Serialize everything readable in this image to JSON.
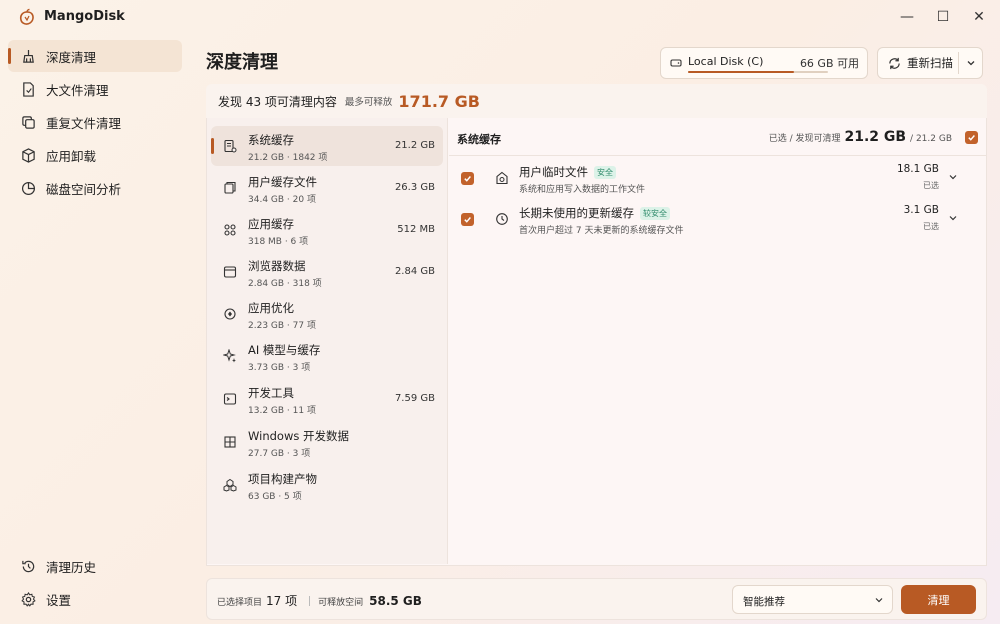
{
  "app": {
    "title": "MangoDisk",
    "logo_icon": "mango-logo-icon"
  },
  "window_controls": {
    "minimize": "—",
    "maximize": "☐",
    "close": "✕"
  },
  "sidebar": {
    "items": [
      {
        "label": "深度清理",
        "icon": "broom-icon",
        "active": true
      },
      {
        "label": "大文件清理",
        "icon": "file-icon",
        "active": false
      },
      {
        "label": "重复文件清理",
        "icon": "copy-icon",
        "active": false
      },
      {
        "label": "应用卸载",
        "icon": "package-icon",
        "active": false
      },
      {
        "label": "磁盘空间分析",
        "icon": "pie-chart-icon",
        "active": false
      }
    ],
    "bottom_items": [
      {
        "label": "清理历史",
        "icon": "history-icon"
      },
      {
        "label": "设置",
        "icon": "gear-icon"
      }
    ]
  },
  "header": {
    "title": "深度清理",
    "disk": {
      "name": "Local Disk (C)",
      "free": "66 GB 可用",
      "used_fraction": 0.76
    },
    "rescan_label": "重新扫描"
  },
  "summary": {
    "found": "发现 43 项可清理内容",
    "estimate": "最多可释放",
    "total": "171.7 GB"
  },
  "categories": [
    {
      "name": "系统缓存",
      "sub": "21.2 GB · 1842 项",
      "size": "21.2 GB",
      "icon": "system-cache-icon",
      "active": true
    },
    {
      "name": "用户缓存文件",
      "sub": "34.4 GB · 20 项",
      "size": "26.3 GB",
      "icon": "user-cache-icon",
      "active": false
    },
    {
      "name": "应用缓存",
      "sub": "318 MB · 6 项",
      "size": "512 MB",
      "icon": "apps-icon",
      "active": false
    },
    {
      "name": "浏览器数据",
      "sub": "2.84 GB · 318 项",
      "size": "2.84 GB",
      "icon": "browser-icon",
      "active": false
    },
    {
      "name": "应用优化",
      "sub": "2.23 GB · 77 项",
      "size": "",
      "icon": "optimize-icon",
      "active": false
    },
    {
      "name": "AI 模型与缓存",
      "sub": "3.73 GB · 3 项",
      "size": "",
      "icon": "ai-icon",
      "active": false
    },
    {
      "name": "开发工具",
      "sub": "13.2 GB · 11 项",
      "size": "7.59 GB",
      "icon": "terminal-icon",
      "active": false
    },
    {
      "name": "Windows 开发数据",
      "sub": "27.7 GB · 3 项",
      "size": "",
      "icon": "windows-icon",
      "active": false
    },
    {
      "name": "项目构建产物",
      "sub": "63 GB · 5 项",
      "size": "",
      "icon": "build-icon",
      "active": false
    }
  ],
  "detail": {
    "title": "系统缓存",
    "selected_label": "已选 / 发现可清理",
    "selected_size": "21.2 GB",
    "total_size": "/ 21.2 GB",
    "items": [
      {
        "name": "用户临时文件",
        "badge": "安全",
        "desc": "系统和应用写入数据的工作文件",
        "size": "18.1 GB",
        "sel": "已选",
        "icon": "temp-file-icon",
        "checked": true
      },
      {
        "name": "长期未使用的更新缓存",
        "badge": "较安全",
        "desc": "首次用户超过 7 天未更新的系统缓存文件",
        "size": "3.1 GB",
        "sel": "已选",
        "icon": "clock-icon",
        "checked": true
      }
    ]
  },
  "footer": {
    "selected_label": "已选择项目",
    "selected_count": "17 项",
    "space_label": "可释放空间",
    "space_value": "58.5 GB",
    "mode": "智能推荐",
    "clean_label": "清理"
  },
  "colors": {
    "accent": "#b85a24",
    "checkbox": "#c2622b",
    "badge_text": "#2e8a6a",
    "badge_bg": "#dcf2e8"
  }
}
